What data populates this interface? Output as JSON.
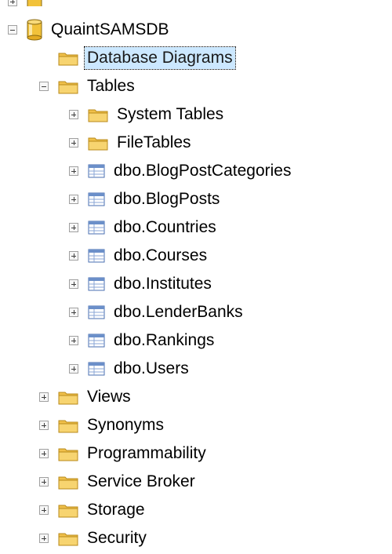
{
  "tree": {
    "database": {
      "label": "QuaintSAMSDB",
      "icon": "database-icon"
    },
    "nodes": [
      {
        "label": "Database Diagrams",
        "icon": "folder-icon",
        "selected": true
      },
      {
        "label": "Tables",
        "icon": "folder-icon",
        "expanded": true
      },
      {
        "label": "System Tables",
        "icon": "folder-icon"
      },
      {
        "label": "FileTables",
        "icon": "folder-icon"
      },
      {
        "label": "dbo.BlogPostCategories",
        "icon": "table-icon"
      },
      {
        "label": "dbo.BlogPosts",
        "icon": "table-icon"
      },
      {
        "label": "dbo.Countries",
        "icon": "table-icon"
      },
      {
        "label": "dbo.Courses",
        "icon": "table-icon"
      },
      {
        "label": "dbo.Institutes",
        "icon": "table-icon"
      },
      {
        "label": "dbo.LenderBanks",
        "icon": "table-icon"
      },
      {
        "label": "dbo.Rankings",
        "icon": "table-icon"
      },
      {
        "label": "dbo.Users",
        "icon": "table-icon"
      },
      {
        "label": "Views",
        "icon": "folder-icon"
      },
      {
        "label": "Synonyms",
        "icon": "folder-icon"
      },
      {
        "label": "Programmability",
        "icon": "folder-icon"
      },
      {
        "label": "Service Broker",
        "icon": "folder-icon"
      },
      {
        "label": "Storage",
        "icon": "folder-icon"
      },
      {
        "label": "Security",
        "icon": "folder-icon"
      }
    ]
  },
  "colors": {
    "selection": "#cce8ff",
    "folder": "#f0c04a",
    "database": "#f2c23a",
    "table": "#6b8fc9"
  }
}
